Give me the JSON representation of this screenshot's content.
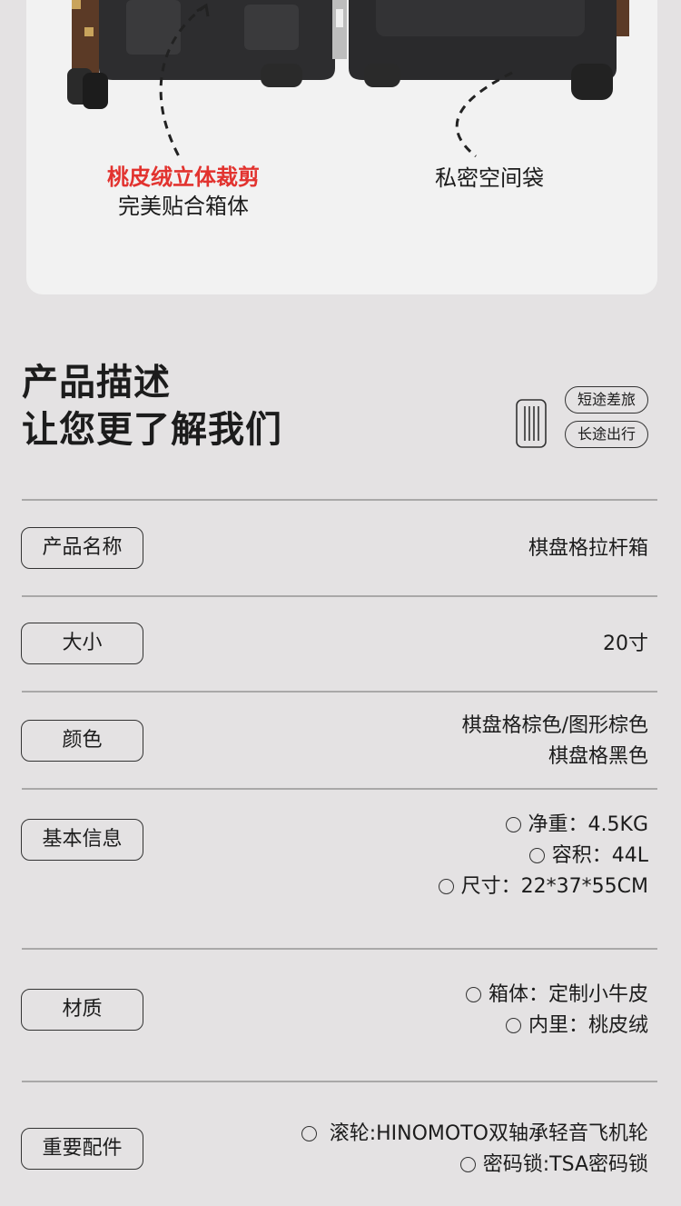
{
  "features": {
    "left_title": "桃皮绒立体裁剪",
    "left_subtitle": "完美贴合箱体",
    "right_title": "私密空间袋"
  },
  "description": {
    "heading_line1": "产品描述",
    "heading_line2": "让您更了解我们",
    "tags": [
      "短途差旅",
      "长途出行"
    ]
  },
  "specs": {
    "name": {
      "label": "产品名称",
      "value": "棋盘格拉杆箱"
    },
    "size": {
      "label": "大小",
      "value": "20寸"
    },
    "color": {
      "label": "颜色",
      "values": [
        "棋盘格棕色/图形棕色",
        "棋盘格黑色"
      ]
    },
    "basic": {
      "label": "基本信息",
      "values": [
        "净重：4.5KG",
        "容积：44L",
        "尺寸：22*37*55CM"
      ]
    },
    "material": {
      "label": "材质",
      "values": [
        "箱体：定制小牛皮",
        "内里：桃皮绒"
      ]
    },
    "parts": {
      "label": "重要配件",
      "values": [
        "滚轮:HINOMOTO双轴承轻音飞机轮",
        "密码锁:TSA密码锁"
      ]
    }
  },
  "colors": {
    "accent_red": "#e2332f",
    "background": "#e4e2e3",
    "card": "#f2f2f2"
  }
}
